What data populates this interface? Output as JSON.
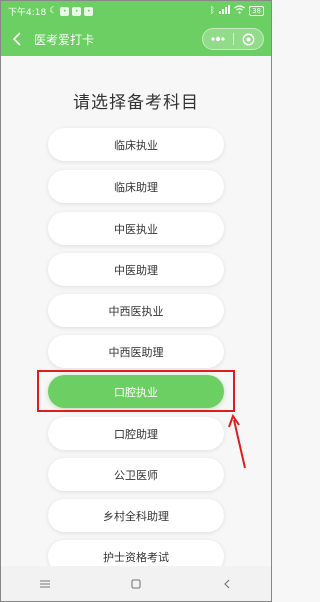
{
  "status": {
    "time": "下午4:18",
    "battery": "38"
  },
  "nav": {
    "title": "医考爱打卡"
  },
  "main": {
    "title": "请选择备考科目",
    "options": [
      {
        "label": "临床执业"
      },
      {
        "label": "临床助理"
      },
      {
        "label": "中医执业"
      },
      {
        "label": "中医助理"
      },
      {
        "label": "中西医执业"
      },
      {
        "label": "中西医助理"
      },
      {
        "label": "口腔执业",
        "selected": true
      },
      {
        "label": "口腔助理"
      },
      {
        "label": "公卫医师"
      },
      {
        "label": "乡村全科助理"
      },
      {
        "label": "护士资格考试"
      }
    ]
  },
  "colors": {
    "accent": "#6ccf63",
    "highlight": "#e01d1d"
  },
  "icons": {
    "back": "chevron-left-icon",
    "more": "more-dots-icon",
    "close": "target-circle-icon",
    "menu": "menu-lines-icon",
    "home": "square-home-icon",
    "return": "chevron-back-icon"
  }
}
